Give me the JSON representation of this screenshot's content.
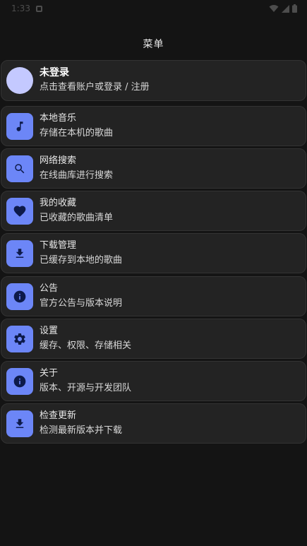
{
  "status_bar": {
    "time": "1:33"
  },
  "header": {
    "title": "菜单"
  },
  "profile": {
    "title": "未登录",
    "subtitle": "点击查看账户或登录 / 注册"
  },
  "menu": [
    {
      "title": "本地音乐",
      "subtitle": "存储在本机的歌曲",
      "icon": "music-note-icon"
    },
    {
      "title": "网络搜索",
      "subtitle": "在线曲库进行搜索",
      "icon": "search-icon"
    },
    {
      "title": "我的收藏",
      "subtitle": "已收藏的歌曲清单",
      "icon": "heart-icon"
    },
    {
      "title": "下载管理",
      "subtitle": "已缓存到本地的歌曲",
      "icon": "download-icon"
    },
    {
      "title": "公告",
      "subtitle": "官方公告与版本说明",
      "icon": "info-icon"
    },
    {
      "title": "设置",
      "subtitle": "缓存、权限、存储相关",
      "icon": "gear-icon"
    },
    {
      "title": "关于",
      "subtitle": "版本、开源与开发团队",
      "icon": "info-icon"
    },
    {
      "title": "检查更新",
      "subtitle": "检测最新版本并下载",
      "icon": "download-icon"
    }
  ],
  "colors": {
    "accent": "#6c86f7",
    "icon_glyph": "#0d1a4a",
    "avatar": "#c4c9ff",
    "card": "#232323",
    "background": "#141414"
  }
}
